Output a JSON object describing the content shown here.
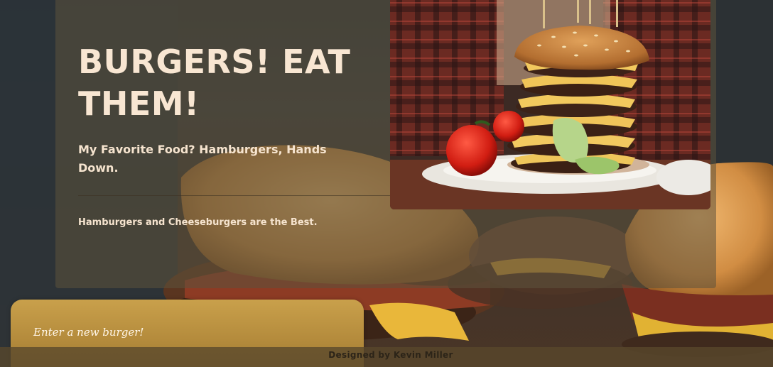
{
  "hero": {
    "title": "BURGERS! EAT THEM!",
    "subtitle": "My Favorite Food? Hamburgers, Hands Down.",
    "body": "Hamburgers and Cheeseburgers are the Best."
  },
  "form": {
    "placeholder": "Enter a new burger!"
  },
  "footer": {
    "text": "Designed by Kevin Miller"
  },
  "colors": {
    "card_overlay": "#5c523c",
    "heading_text": "#f8e6d2",
    "form_gold": "#c9a04b",
    "footer_bar": "#58482c"
  },
  "images": {
    "background": "burgers-background-photo",
    "hero_photo": "stacked-cheeseburger-photo"
  }
}
